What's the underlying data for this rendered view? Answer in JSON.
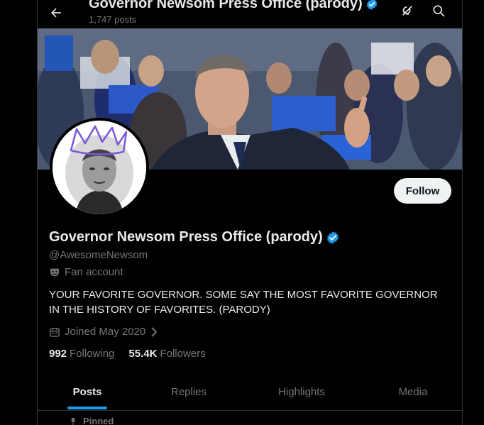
{
  "header": {
    "title": "Governor Newsom Press Office (parody)",
    "posts_count": "1,747 posts"
  },
  "icons": {
    "back": "arrow-left-icon",
    "grok": "grok-icon",
    "search": "search-icon",
    "verified": "verified-badge-icon",
    "fan": "theater-mask-icon",
    "calendar": "calendar-icon",
    "pin": "pin-icon"
  },
  "profile": {
    "name": "Governor Newsom Press Office (parody)",
    "handle": "@AwesomeNewsom",
    "label": "Fan account",
    "bio": "YOUR FAVORITE GOVERNOR. SOME SAY THE MOST FAVORITE GOVERNOR IN THE HISTORY OF FAVORITES. (PARODY)",
    "joined": "Joined May 2020",
    "following_count": "992",
    "following_label": "Following",
    "followers_count": "55.4K",
    "followers_label": "Followers",
    "follow_button": "Follow"
  },
  "tabs": [
    {
      "label": "Posts",
      "active": true
    },
    {
      "label": "Replies",
      "active": false
    },
    {
      "label": "Highlights",
      "active": false
    },
    {
      "label": "Media",
      "active": false
    }
  ],
  "pinned_label": "Pinned",
  "colors": {
    "accent": "#1d9bf0",
    "background": "#000000",
    "text": "#e7e9ea",
    "muted": "#71767b",
    "crown": "#7b57d6"
  }
}
